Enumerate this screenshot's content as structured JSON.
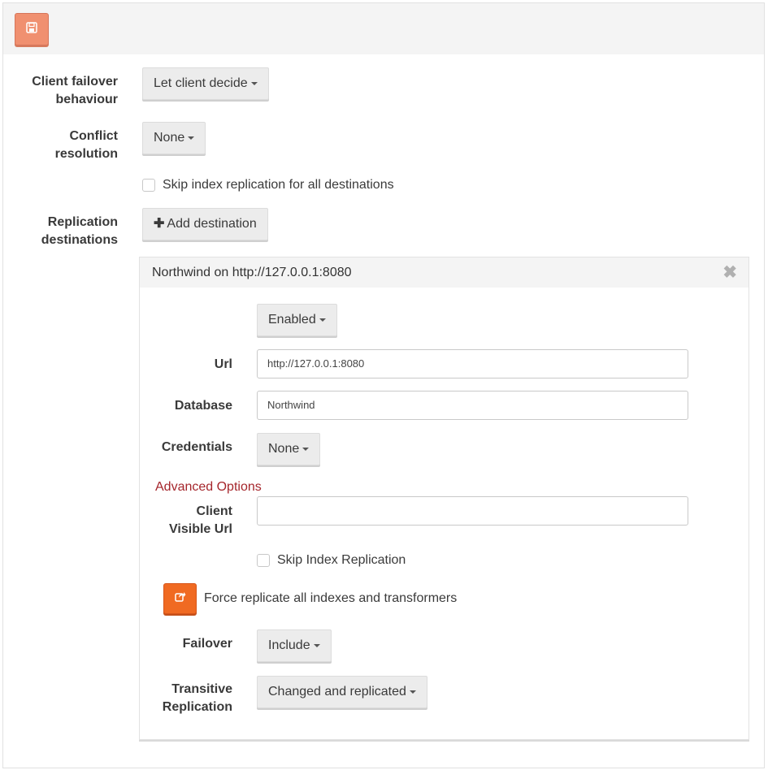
{
  "toolbar": {
    "save_icon": "floppy-disk-icon",
    "accent": "#f09070"
  },
  "client_failover": {
    "label_line1": "Client failover",
    "label_line2": "behaviour",
    "value": "Let client decide"
  },
  "conflict_resolution": {
    "label_line1": "Conflict",
    "label_line2": "resolution",
    "value": "None"
  },
  "skip_index_all": {
    "label": "Skip index replication for all destinations",
    "checked": false
  },
  "replication_destinations": {
    "label_line1": "Replication",
    "label_line2": "destinations",
    "add_button": "Add destination",
    "add_icon": "plus-icon"
  },
  "destination": {
    "title": "Northwind on http://127.0.0.1:8080",
    "close_icon": "close-icon",
    "status": "Enabled",
    "url_label": "Url",
    "url_value": "http://127.0.0.1:8080",
    "database_label": "Database",
    "database_value": "Northwind",
    "credentials_label": "Credentials",
    "credentials_value": "None",
    "advanced_options": "Advanced Options",
    "client_visible_url_line1": "Client",
    "client_visible_url_line2": "Visible Url",
    "client_visible_url_value": "",
    "skip_index_replication": "Skip Index Replication",
    "force_replicate_label": "Force replicate all indexes and transformers",
    "force_icon": "share-icon",
    "force_color": "#f06a22",
    "failover_label": "Failover",
    "failover_value": "Include",
    "transitive_line1": "Transitive",
    "transitive_line2": "Replication",
    "transitive_value": "Changed and replicated"
  }
}
